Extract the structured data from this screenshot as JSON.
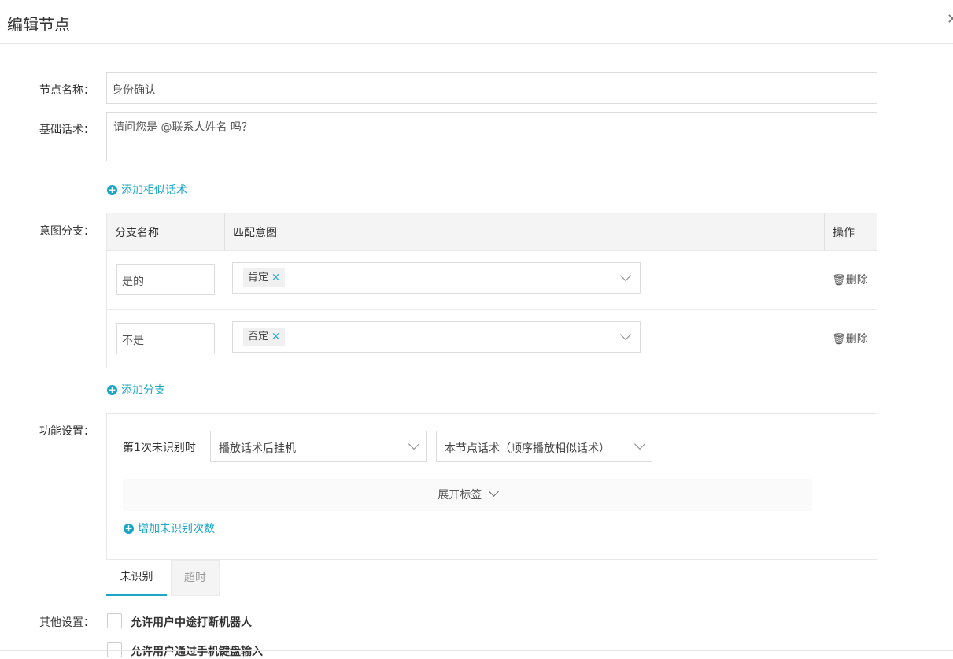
{
  "dialog": {
    "title": "编辑节点",
    "close_icon": "close-icon"
  },
  "form": {
    "node_name_label": "节点名称：",
    "node_name_value": "身份确认",
    "base_script_label": "基础话术：",
    "base_script_value": "请问您是 @联系人姓名 吗？",
    "add_similar_script": "添加相似话术",
    "intent_branch_label": "意图分支：",
    "add_branch": "添加分支",
    "function_settings_label": "功能设置：",
    "other_settings_label": "其他设置："
  },
  "branch_table": {
    "columns": [
      "分支名称",
      "匹配意图",
      "操作"
    ],
    "rows": [
      {
        "name": "是的",
        "intents": [
          "肯定"
        ],
        "action": "删除"
      },
      {
        "name": "不是",
        "intents": [
          "否定"
        ],
        "action": "删除"
      }
    ]
  },
  "function": {
    "first_unrecognized_label": "第1次未识别时",
    "action_select_value": "播放话术后挂机",
    "script_select_value": "本节点话术（顺序播放相似话术）",
    "expand_tags": "展开标签",
    "add_unrecognized_count": "增加未识别次数",
    "tabs": [
      "未识别",
      "超时"
    ],
    "active_tab": "未识别"
  },
  "other": {
    "options": [
      "允许用户中途打断机器人",
      "允许用户通过手机键盘输入"
    ],
    "checked": [
      false,
      false
    ]
  },
  "colors": {
    "accent": "#1aa7c6",
    "border": "#dcdcdc",
    "header_bg": "#f4f4f4"
  }
}
